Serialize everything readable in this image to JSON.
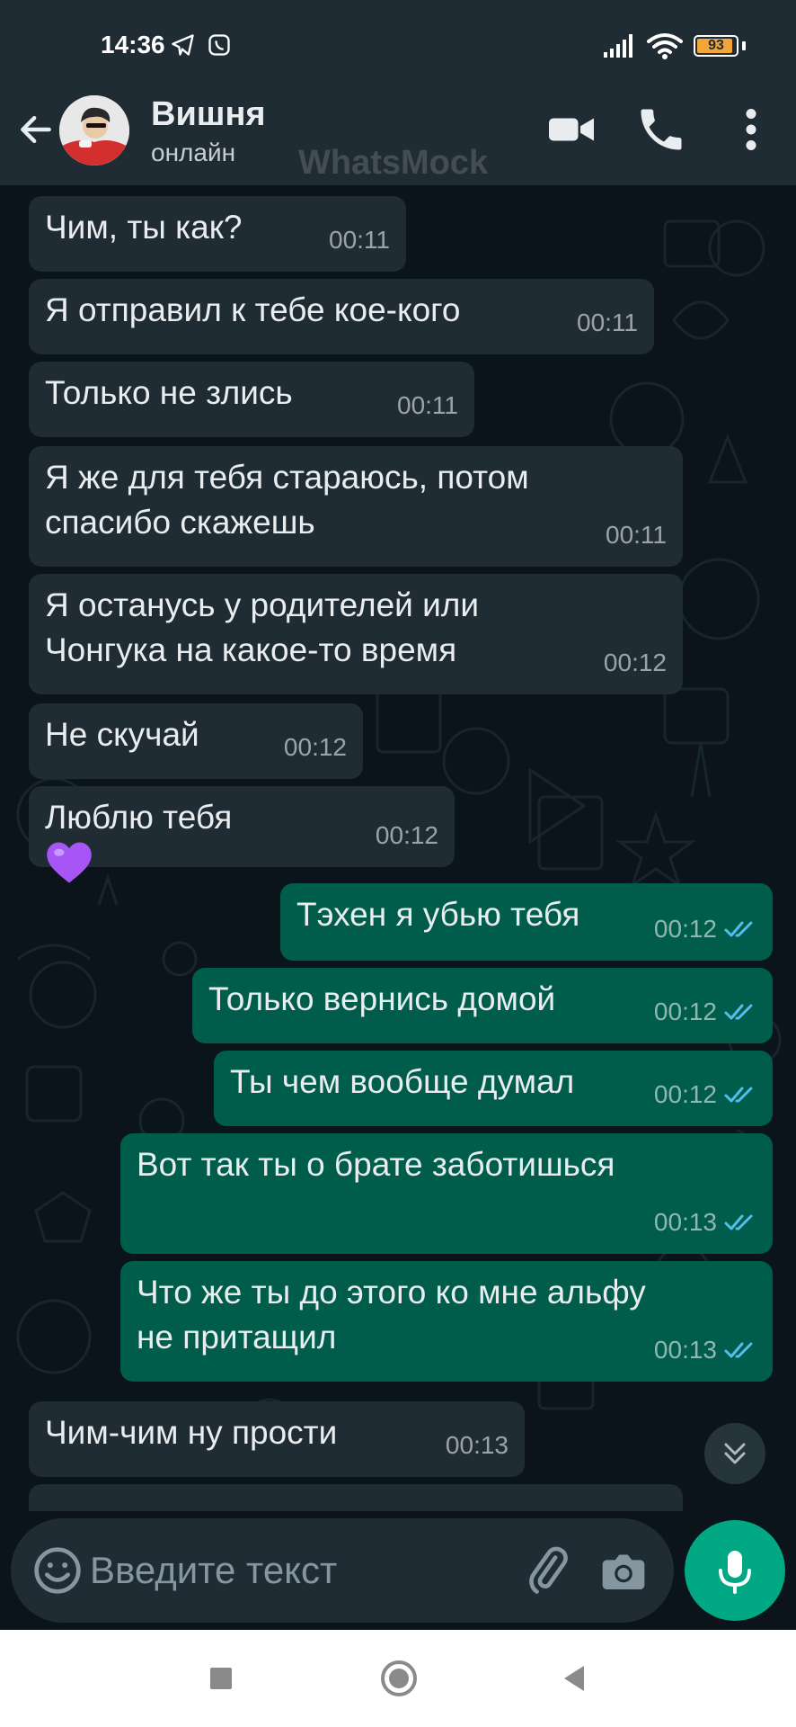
{
  "status_bar": {
    "time": "14:36",
    "battery_percent": "93",
    "icons": [
      "telegram-icon",
      "viber-icon",
      "signal-icon",
      "wifi-icon",
      "battery-icon"
    ],
    "battery_color": "#f2a63a"
  },
  "header": {
    "contact_name": "Вишня",
    "contact_status": "онлайн",
    "watermark": "WhatsMock",
    "icons": [
      "back-arrow-icon",
      "video-call-icon",
      "phone-icon",
      "more-vert-icon"
    ],
    "background": "#1f2c33"
  },
  "messages": [
    {
      "dir": "in",
      "text": "Чим, ты как?",
      "time": "00:11"
    },
    {
      "dir": "in",
      "text": "Я отправил к тебе кое-кого",
      "time": "00:11"
    },
    {
      "dir": "in",
      "text": "Только не злись",
      "time": "00:11"
    },
    {
      "dir": "in",
      "text": "Я же для тебя стараюсь, потом\nспасибо скажешь",
      "time": "00:11"
    },
    {
      "dir": "in",
      "text": "Я останусь у родителей или\nЧонгука на какое-то время",
      "time": "00:12"
    },
    {
      "dir": "in",
      "text": "Не скучай",
      "time": "00:12"
    },
    {
      "dir": "in",
      "text": "Люблю тебя",
      "emoji": "purple-heart-icon",
      "time": "00:12"
    },
    {
      "dir": "out",
      "text": "Тэхен я убью тебя",
      "time": "00:12",
      "read": true
    },
    {
      "dir": "out",
      "text": "Только вернись домой",
      "time": "00:12",
      "read": true
    },
    {
      "dir": "out",
      "text": "Ты чем вообще думал",
      "time": "00:12",
      "read": true
    },
    {
      "dir": "out",
      "text": "Вот так ты о брате заботишься",
      "time": "00:13",
      "read": true
    },
    {
      "dir": "out",
      "text": "Что же ты до этого ко мне альфу\nне притащил",
      "time": "00:13",
      "read": true
    },
    {
      "dir": "in",
      "text": "Чим-чим ну прости",
      "time": "00:13"
    }
  ],
  "input": {
    "placeholder": "Введите текст",
    "icons": [
      "emoji-icon",
      "attach-icon",
      "camera-icon",
      "mic-icon"
    ]
  },
  "nav_bar": {
    "icons": [
      "recents-square-icon",
      "home-circle-icon",
      "back-triangle-icon"
    ]
  },
  "colors": {
    "chat_background": "#0b141a",
    "incoming_bubble": "#202c33",
    "outgoing_bubble": "#005c4b",
    "accent": "#00a884",
    "read_ticks": "#53bdeb"
  }
}
